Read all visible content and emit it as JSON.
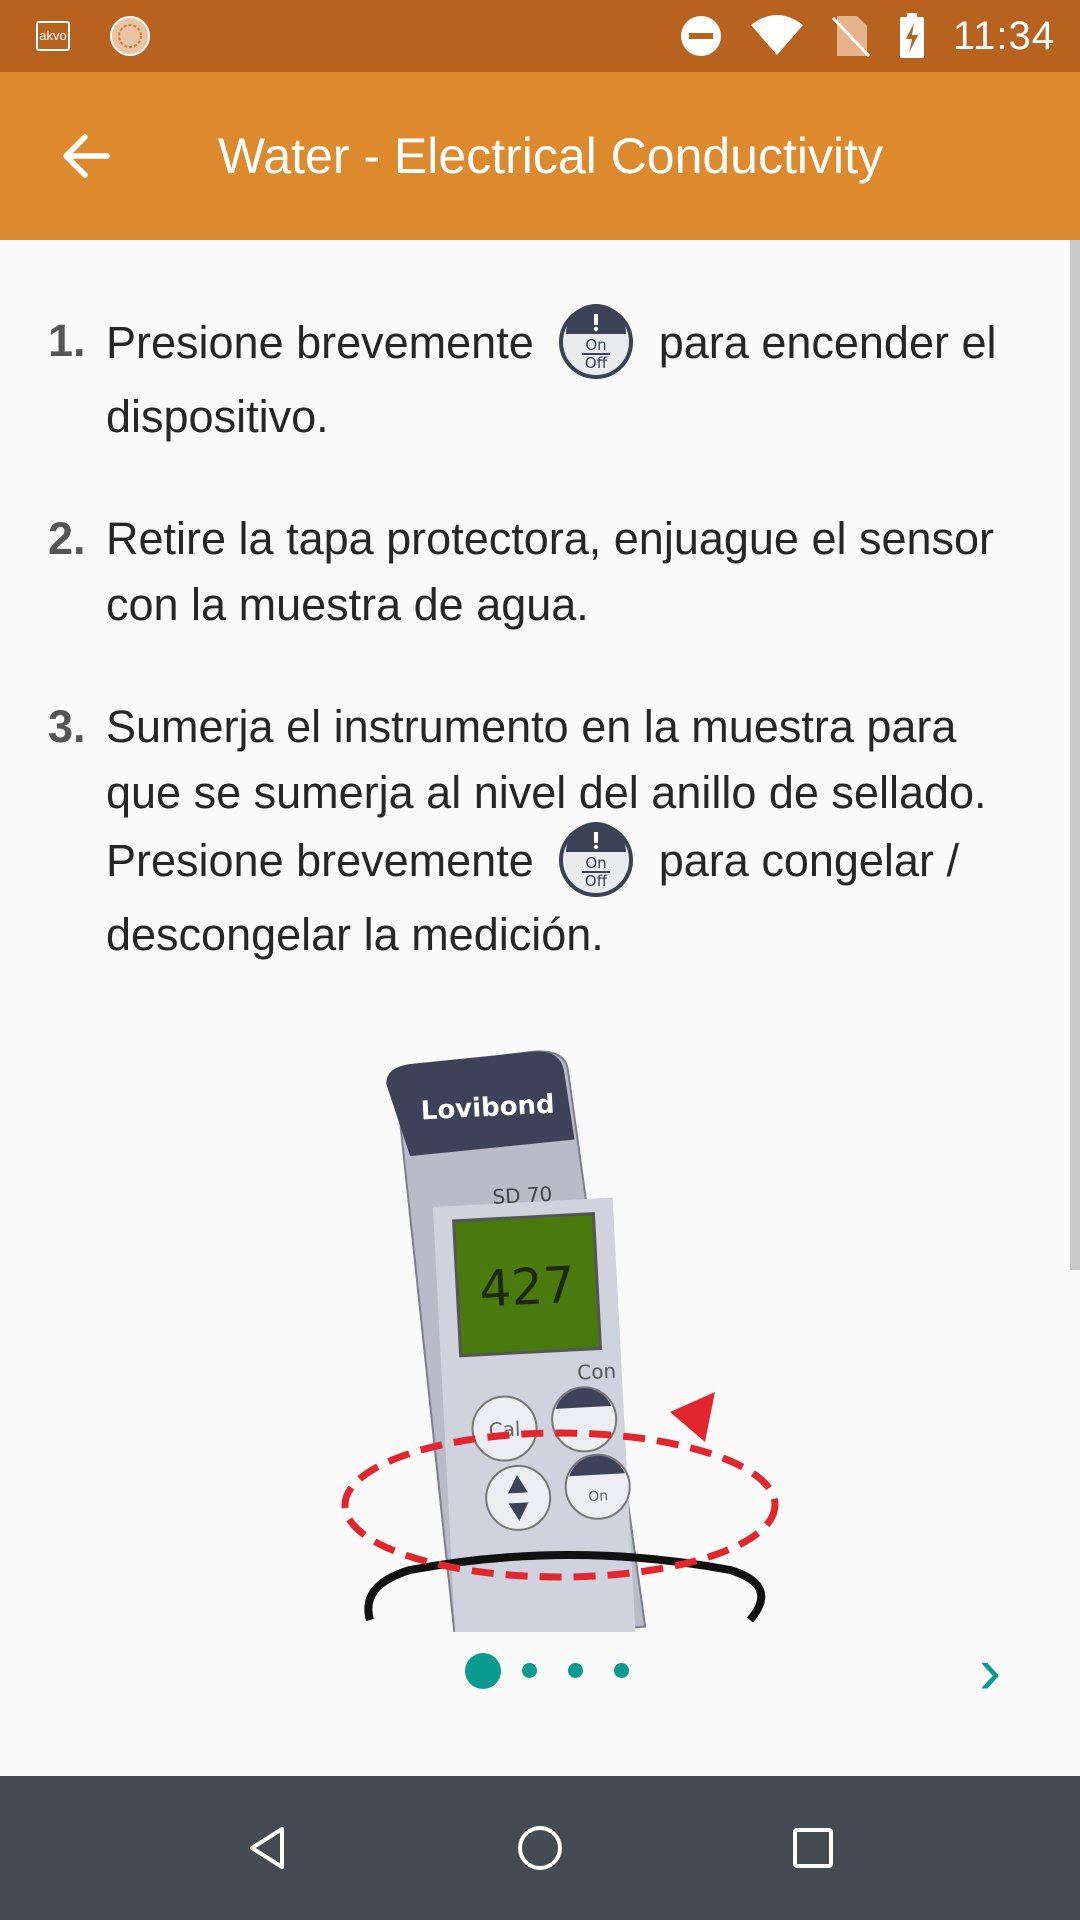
{
  "status_bar": {
    "app_icon_label": "akvo",
    "time": "11:34",
    "icons": [
      "akvo-icon",
      "sun-icon",
      "do-not-disturb-icon",
      "wifi-icon",
      "no-sim-icon",
      "battery-charging-icon"
    ]
  },
  "app_bar": {
    "title": "Water - Electrical Conductivity",
    "back_icon": "arrow-left-icon"
  },
  "steps": [
    {
      "number": "1.",
      "text_before": "Presione brevemente",
      "text_after": "para encender el dispositivo.",
      "icon": "on-off-button-icon"
    },
    {
      "number": "2.",
      "text": "Retire la tapa protectora, enjuague el sensor con la muestra de agua."
    },
    {
      "number": "3.",
      "text_before": "Sumerja el instrumento en la muestra para que se sumerja al nivel del anillo de sellado. Presione brevemente",
      "text_after": "para congelar / descongelar la medición.",
      "icon": "on-off-button-icon"
    }
  ],
  "onoff_icon": {
    "on": "On",
    "off": "Off"
  },
  "illustration": {
    "brand": "Lovibond",
    "model": "SD  70",
    "display_value": "427",
    "unit_label": "Con",
    "cal_label": "Cal",
    "on_label": "On"
  },
  "pager": {
    "page_count": 4,
    "current_page": 1,
    "next_label": "›"
  },
  "colors": {
    "status_bar": "#b8621f",
    "app_bar": "#dc8a2d",
    "accent": "#0a9a8f",
    "nav_bar": "#454b52",
    "background": "#fafafa"
  }
}
